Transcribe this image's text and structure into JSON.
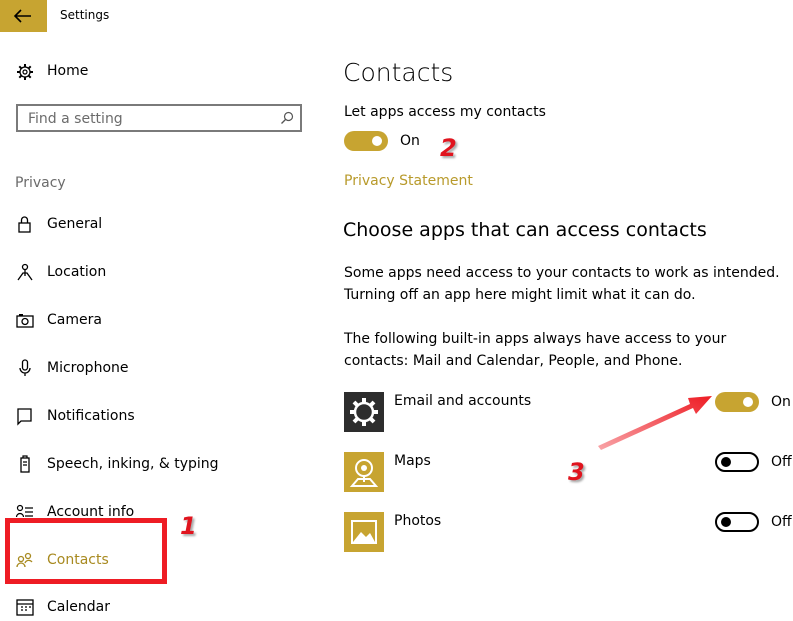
{
  "window": {
    "title": "Settings"
  },
  "sidebar": {
    "home_label": "Home",
    "search_placeholder": "Find a setting",
    "section_heading": "Privacy",
    "items": [
      {
        "label": "General",
        "icon": "lock-icon"
      },
      {
        "label": "Location",
        "icon": "location-icon"
      },
      {
        "label": "Camera",
        "icon": "camera-icon"
      },
      {
        "label": "Microphone",
        "icon": "microphone-icon"
      },
      {
        "label": "Notifications",
        "icon": "notifications-icon"
      },
      {
        "label": "Speech, inking, & typing",
        "icon": "speech-icon"
      },
      {
        "label": "Account info",
        "icon": "account-info-icon"
      },
      {
        "label": "Contacts",
        "icon": "contacts-icon",
        "selected": true
      },
      {
        "label": "Calendar",
        "icon": "calendar-icon"
      }
    ]
  },
  "main": {
    "title": "Contacts",
    "master_setting": {
      "label": "Let apps access my contacts",
      "state": "On"
    },
    "privacy_link": "Privacy Statement",
    "section_heading": "Choose apps that can access contacts",
    "description_1": "Some apps need access to your contacts to work as intended. Turning off an app here might limit what it can do.",
    "description_2": "The following built-in apps always have access to your contacts: Mail and Calendar, People, and Phone.",
    "apps": [
      {
        "name": "Email and accounts",
        "state": "On",
        "icon": "gear-icon"
      },
      {
        "name": "Maps",
        "state": "Off",
        "icon": "maps-icon"
      },
      {
        "name": "Photos",
        "state": "Off",
        "icon": "photos-icon"
      }
    ]
  },
  "annotations": {
    "step1": "1",
    "step2": "2",
    "step3": "3"
  },
  "colors": {
    "accent": "#c7a431",
    "annotation_red": "#ee1c24"
  }
}
